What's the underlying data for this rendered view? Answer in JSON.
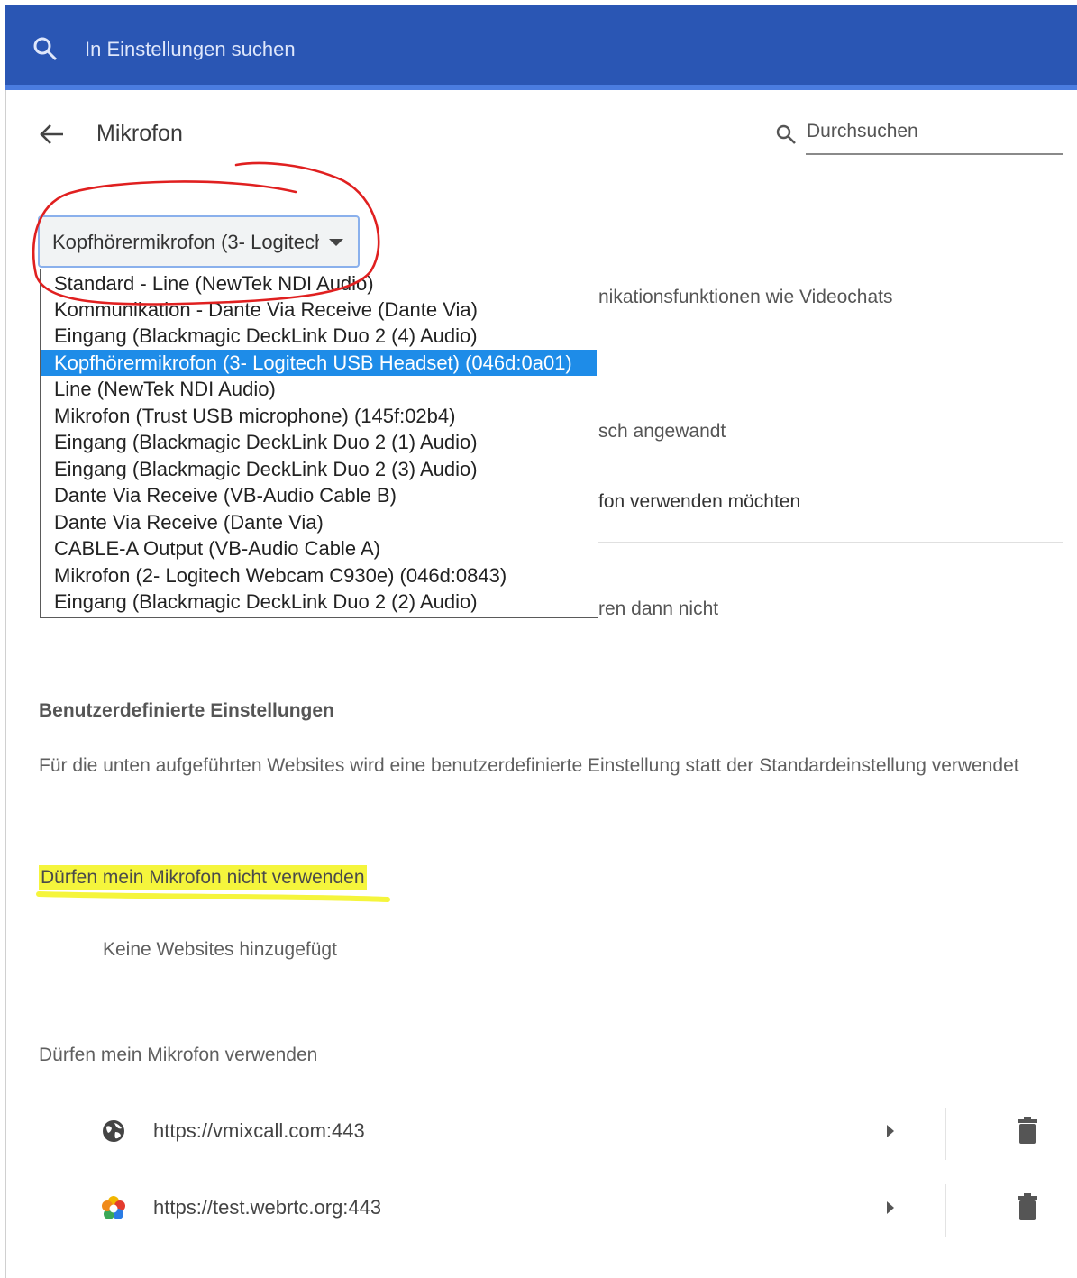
{
  "topbar": {
    "search_placeholder": "In Einstellungen suchen"
  },
  "header": {
    "title": "Mikrofon",
    "search_placeholder": "Durchsuchen"
  },
  "device_select": {
    "current": "Kopfhörermikrofon (3- Logitech USB Headset) (046d:0a01)",
    "options": [
      "Standard - Line (NewTek NDI Audio)",
      "Kommunikation - Dante Via Receive (Dante Via)",
      "Eingang (Blackmagic DeckLink Duo 2 (4) Audio)",
      "Kopfhörermikrofon (3- Logitech USB Headset) (046d:0a01)",
      "Line (NewTek NDI Audio)",
      "Mikrofon (Trust USB microphone) (145f:02b4)",
      "Eingang (Blackmagic DeckLink Duo 2 (1) Audio)",
      "Eingang (Blackmagic DeckLink Duo 2 (3) Audio)",
      "Dante Via Receive (VB-Audio Cable B)",
      "Dante Via Receive (Dante Via)",
      "CABLE-A Output (VB-Audio Cable A)",
      "Mikrofon (2- Logitech Webcam C930e) (046d:0843)",
      "Eingang (Blackmagic DeckLink Duo 2 (2) Audio)"
    ]
  },
  "obscured_text": {
    "line1": "nikationsfunktionen wie Videochats",
    "line2": "sch angewandt",
    "line3": "fon verwenden möchten",
    "line4": "ren dann nicht"
  },
  "custom_settings": {
    "heading": "Benutzerdefinierte Einstellungen",
    "description": "Für die unten aufgeführten Websites wird eine benutzerdefinierte Einstellung statt der Standardeinstellung verwendet"
  },
  "blocked": {
    "heading": "Dürfen mein Mikrofon nicht verwenden",
    "empty_text": "Keine Websites hinzugefügt"
  },
  "allowed": {
    "heading": "Dürfen mein Mikrofon verwenden",
    "sites": [
      {
        "url": "https://vmixcall.com:443",
        "icon": "globe-icon"
      },
      {
        "url": "https://test.webrtc.org:443",
        "icon": "webrtc-logo-icon"
      }
    ]
  },
  "colors": {
    "topbar": "#2a56b4",
    "selection": "#1e8ce8",
    "annotation_circle": "#e02020",
    "highlight": "#f5f53c"
  }
}
